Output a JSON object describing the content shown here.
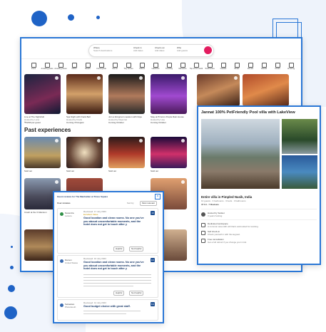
{
  "colors": {
    "accent": "#2a77d6",
    "dot": "#1f63c6",
    "search_button": "#e31c5f",
    "review_green": "#2f8f46",
    "score_blue": "#1f4f91"
  },
  "search": {
    "segments": [
      {
        "label": "Where",
        "sub": "Search destinations"
      },
      {
        "label": "Check in",
        "sub": "Add dates"
      },
      {
        "label": "Check out",
        "sub": "Add dates"
      },
      {
        "label": "Who",
        "sub": "Add guests"
      }
    ],
    "button_icon": "search-icon"
  },
  "categories": [
    "Icons",
    "Amazing pools",
    "Amazing views",
    "OMG!",
    "Beach",
    "Countryside",
    "Farms",
    "Tiny homes",
    "Cabins",
    "Lakefront",
    "Trending",
    "Mansions",
    "Top of the world",
    "Treehouses",
    "Castles",
    "Boats",
    "Domes",
    "Islands",
    "Caves",
    "Amazing"
  ],
  "experiences": [
    {
      "line1": "Live at The Nightclub",
      "line2": "Hosted by Luna",
      "line3": "₹5,840 per guest"
    },
    {
      "line1": "Spa Night with Frank Bell",
      "line2": "Hosted by Frank",
      "line3": "Coming 15 August"
    },
    {
      "line1": "Join a livingroom session with Doja",
      "line2": "Hosted by Doja Cat",
      "line3": "Coming October"
    },
    {
      "line1": "Stay at Prince's Purple Rain House",
      "line2": "Hosted by Lisa",
      "line3": "Coming October"
    }
  ],
  "past_title": "Past experiences",
  "past_cards": [
    {
      "label": "Sold out"
    },
    {
      "label": "Sold out"
    },
    {
      "label": "Sold out"
    },
    {
      "label": "Sold out"
    },
    {
      "label": "Crash at the X-Mansion"
    },
    {
      "label": "Sold out"
    },
    {
      "label": "Sold out"
    },
    {
      "label": "Sold out"
    }
  ],
  "reviews_panel": {
    "title": "Guest reviews for The Manhattan at Times Square",
    "user_reviews_label": "User reviews",
    "sort_label": "Sort by",
    "sort_value": "Most relevant",
    "close_icon": "close-icon",
    "reviews": [
      {
        "name": "Narendra",
        "meta": "Leisure",
        "date": "Reviewed: 17 July 2023",
        "badge": "Excellent Value",
        "headline": "Good location and clean rooms. No one you've you aboud uncomfortable moments, and the hotel does not get in touch after y",
        "score": "10",
        "helpful": "Helpful",
        "not_helpful": "Not helpful"
      },
      {
        "name": "Ramon",
        "meta": "United States",
        "date": "Reviewed: 16 July 2023",
        "badge": "",
        "headline": "Good location and clean rooms. No one you've you aboud uncomfortable moments, and the hotel does not get in touch after y",
        "score": "9.0",
        "helpful": "Helpful",
        "not_helpful": "Not helpful"
      },
      {
        "name": "Sebastian",
        "meta": "Photobooth",
        "date": "Reviewed: 12 July 2023",
        "badge": "",
        "headline": "Good budget choice with great staff.",
        "score": "8.0",
        "helpful": "Helpful",
        "not_helpful": "Not helpful"
      }
    ]
  },
  "listing_panel": {
    "title": "Jannat 100% PetFriendly Pool villa with LakeView",
    "subtitle": "Entire villa in Pimpled Nasik, India",
    "details": "10 guests · 3 bedrooms · 3 beds · 3 bathrooms",
    "rating": "★ 5.0 · 7 Reviews",
    "host": "Hosted by Sanket",
    "host_sub": "3 years hosting",
    "amenities": [
      {
        "title": "Dedicated workspace",
        "sub": "A common area with wifi that's well-suited for working."
      },
      {
        "title": "Self check-in",
        "sub": "Check yourself in with the keypad."
      },
      {
        "title": "Free cancellation",
        "sub": "Get a full refund if you change your mind."
      }
    ]
  }
}
